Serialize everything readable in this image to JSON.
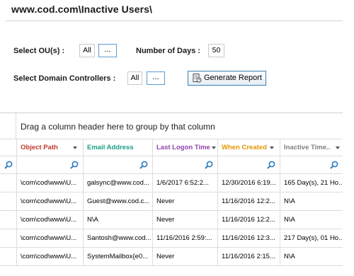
{
  "header": {
    "title": "www.cod.com\\Inactive Users\\"
  },
  "form": {
    "ou_label": "Select OU(s)  :",
    "ou_value": "All",
    "ou_browse": "...",
    "days_label": "Number of Days :",
    "days_value": "50",
    "dc_label": "Select Domain Controllers  :",
    "dc_value": "All",
    "dc_browse": "...",
    "generate_label": "Generate Report"
  },
  "grid": {
    "group_hint": "Drag a column header here to group by that column",
    "columns": [
      {
        "label": "Object Path",
        "color": "#c0392b"
      },
      {
        "label": "Email Address",
        "color": "#16a085"
      },
      {
        "label": "Last Logon Time",
        "color": "#8e44ad"
      },
      {
        "label": "When Created",
        "color": "#e69500"
      },
      {
        "label": "Inactive Time..",
        "color": "#7f7f7f"
      }
    ],
    "rows": [
      [
        "\\com\\cod\\www\\U...",
        "galsync@www.cod...",
        "1/6/2017 6:52:2...",
        "12/30/2016 6:19...",
        "165 Day(s), 21 Ho..."
      ],
      [
        "\\com\\cod\\www\\U...",
        "Guest@www.cod.c...",
        "Never",
        "11/16/2016 12:2...",
        "N\\A"
      ],
      [
        "\\com\\cod\\www\\U...",
        "N\\A",
        "Never",
        "11/16/2016 12:2...",
        "N\\A"
      ],
      [
        "\\com\\cod\\www\\U...",
        "Santosh@www.cod...",
        "11/16/2016 2:59:...",
        "11/16/2016 12:3...",
        "217 Day(s), 01 Ho..."
      ],
      [
        "\\com\\cod\\www\\U...",
        "SystemMailbox{e0...",
        "Never",
        "11/16/2016 2:15...",
        "N\\A"
      ]
    ]
  }
}
